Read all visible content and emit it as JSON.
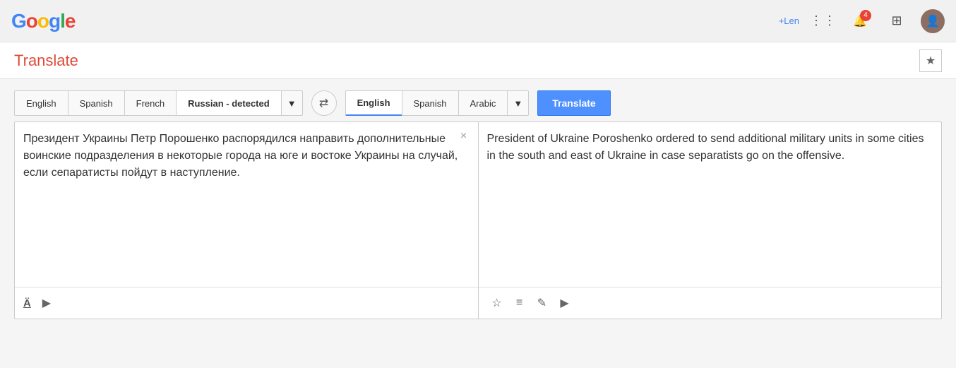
{
  "header": {
    "logo": "Google",
    "user_name": "+Len",
    "notification_count": "4"
  },
  "page": {
    "title": "Translate",
    "star_label": "★"
  },
  "source_lang_tabs": [
    {
      "label": "English",
      "id": "english"
    },
    {
      "label": "Spanish",
      "id": "spanish"
    },
    {
      "label": "French",
      "id": "french"
    },
    {
      "label": "Russian - detected",
      "id": "russian-detected"
    }
  ],
  "target_lang_tabs": [
    {
      "label": "English",
      "id": "english"
    },
    {
      "label": "Spanish",
      "id": "spanish"
    },
    {
      "label": "Arabic",
      "id": "arabic"
    }
  ],
  "translate_button_label": "Translate",
  "source_text": "Президент Украины Петр Порошенко распорядился направить дополнительные воинские подразделения в некоторые города на юге и востоке Украины на случай, если сепаратисты пойдут в наступление.",
  "translated_text": "President of Ukraine Poroshenko ordered to send additional military units in some cities in the south and east of Ukraine in case separatists go on the offensive.",
  "icons": {
    "swap": "⇄",
    "dropdown_arrow": "▾",
    "clear": "×",
    "star": "☆",
    "list": "≡",
    "pencil": "✎",
    "sound": "♪",
    "apps_grid": "⋮⋮⋮",
    "bell": "🔔",
    "plus_square": "⊞",
    "footnote_a": "Ä"
  }
}
